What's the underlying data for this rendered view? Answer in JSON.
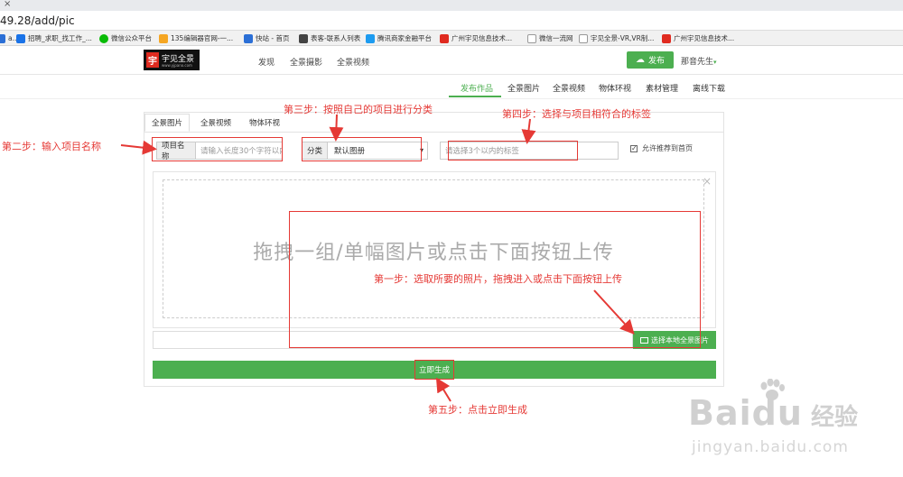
{
  "browser": {
    "tab_close": "×",
    "url": "49.28/add/pic",
    "bookmarks": [
      {
        "label": "а...",
        "color": "#2b6fd6"
      },
      {
        "label": "招聘_求职_找工作_...",
        "color": "#1a73e8"
      },
      {
        "label": "微信公众平台",
        "color": "#09bb07"
      },
      {
        "label": "135编辑器官网-一...",
        "color": "#f5a623"
      },
      {
        "label": "快站 - 首页",
        "color": "#2b6fd6"
      },
      {
        "label": "表客-联系人列表",
        "color": "#444444"
      },
      {
        "label": "腾讯商家金融平台",
        "color": "#1d9bf0"
      },
      {
        "label": "广州宇见信息技术...",
        "color": "#e02b20"
      },
      {
        "label": "微信一流网",
        "color": "#999999"
      },
      {
        "label": "宇见全景-VR,VR制...",
        "color": "#999999"
      },
      {
        "label": "广州宇见信息技术...",
        "color": "#e02b20"
      }
    ]
  },
  "header": {
    "logo_mark": "宇",
    "logo_text": "宇见全景",
    "logo_sub": "www.yjpano.com",
    "nav": [
      "发现",
      "全景摄影",
      "全景视频"
    ],
    "publish_label": "发布",
    "publish_icon": "cloud-upload-icon",
    "user_name": "那音先生",
    "user_caret": "▾"
  },
  "subnav": {
    "items": [
      "发布作品",
      "全景图片",
      "全景视频",
      "物体环视",
      "素材管理",
      "离线下载"
    ],
    "active_color": "#4caf50"
  },
  "form": {
    "tabs": [
      "全景图片",
      "全景视频",
      "物体环视"
    ],
    "name_label": "项目名称",
    "name_placeholder": "请输入长度30个字符以内",
    "category_label": "分类",
    "category_value": "默认图册",
    "category_arrow": "▾",
    "tags_placeholder": "请选择3个以内的标签",
    "recommend_label": "允许推荐到首页",
    "recommend_checked": true,
    "check_mark": "✓"
  },
  "upload": {
    "drop_text": "拖拽一组/单幅图片或点击下面按钮上传",
    "close_glyph": "×",
    "local_button": "选择本地全景图片",
    "generate_button": "立即生成"
  },
  "annotations": {
    "step1": "第一步：选取所要的照片，拖拽进入或点击下面按钮上传",
    "step2": "第二步：输入项目名称",
    "step3": "第三步：按照自己的项目进行分类",
    "step4": "第四步：选择与项目相符合的标签",
    "step5": "第五步：点击立即生成",
    "color": "#e53935"
  },
  "watermark": {
    "brand": "Baidu",
    "brand_cn": "经验",
    "url": "jingyan.baidu.com"
  }
}
